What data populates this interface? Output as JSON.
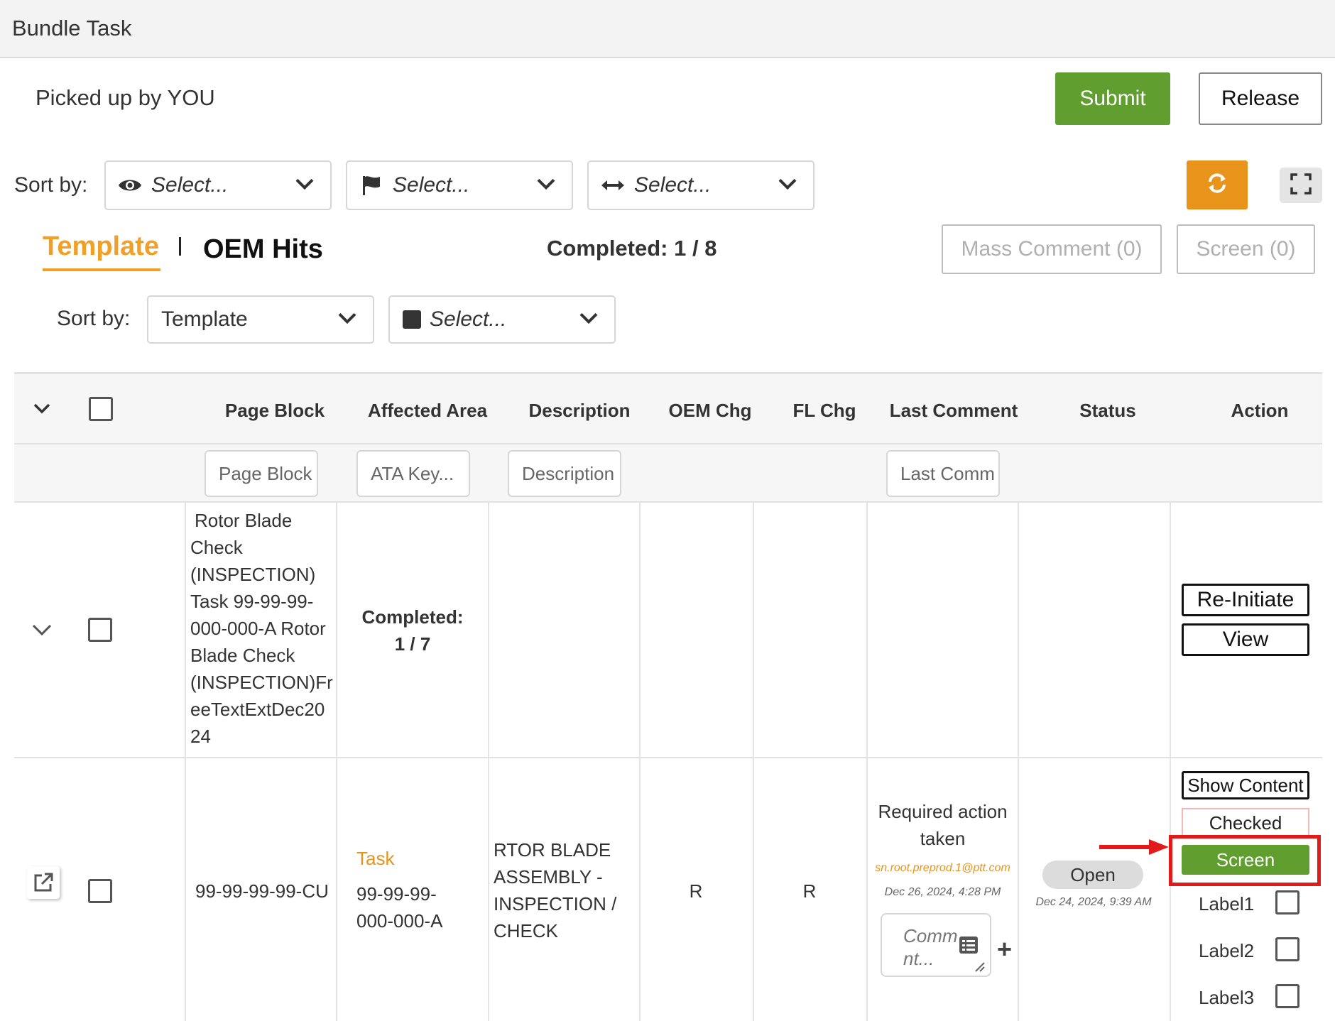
{
  "window": {
    "title": "Bundle Task"
  },
  "header": {
    "picked_by": "Picked up by YOU",
    "submit_label": "Submit",
    "release_label": "Release"
  },
  "sort_bar": {
    "label": "Sort by:",
    "selects": [
      {
        "icon": "eye-icon",
        "placeholder": "Select..."
      },
      {
        "icon": "flag-icon",
        "placeholder": "Select..."
      },
      {
        "icon": "horizontal-arrows-icon",
        "placeholder": "Select..."
      }
    ]
  },
  "tabs": {
    "template_label": "Template",
    "oem_label": "OEM Hits",
    "completed": "Completed: 1 / 8"
  },
  "actions": {
    "mass_comment_label": "Mass Comment (0)",
    "screen_label": "Screen (0)"
  },
  "sort_bar2": {
    "label": "Sort by:",
    "template_value": "Template",
    "color_placeholder": "Select..."
  },
  "table": {
    "columns": [
      "Page Block",
      "Affected Area",
      "Description",
      "OEM Chg",
      "FL Chg",
      "Last Comment",
      "Status",
      "Action"
    ],
    "filters": {
      "page_block": "Page Block",
      "affected_area": "ATA Key...",
      "description": "Description",
      "last_comment": "Last Comm"
    },
    "group_row": {
      "page_block_lines": [
        "Rotor Blade",
        "Check",
        "(INSPECTION)",
        "Task 99-99-99-",
        "000-000-A Rotor",
        "Blade Check",
        "(INSPECTION)Fr",
        "eeTextExtDec20",
        "24"
      ],
      "completed_label": "Completed:",
      "completed_value": "1 / 7",
      "reinitiate_label": "Re-Initiate",
      "view_label": "View"
    },
    "task_row": {
      "page_block": "99-99-99-99-CU",
      "area_type": "Task",
      "area_code_lines": [
        "99-99-99-",
        "000-000-A"
      ],
      "description_lines": [
        "RTOR BLADE",
        "ASSEMBLY -",
        "INSPECTION /",
        "CHECK"
      ],
      "oem_chg": "R",
      "fl_chg": "R",
      "last_comment_lines": [
        "Required action",
        "taken"
      ],
      "comment_author": "sn.root.preprod.1@ptt.com",
      "comment_date": "Dec 26, 2024, 4:28 PM",
      "comment_placeholder_lines": [
        "Comm",
        "nt..."
      ],
      "status": "Open",
      "status_date": "Dec 24, 2024, 9:39 AM",
      "show_content_label": "Show Content",
      "checked_label": "Checked",
      "screen_label": "Screen",
      "labels": [
        "Label1",
        "Label2",
        "Label3"
      ]
    }
  },
  "colors": {
    "green": "#5f9e2f",
    "orange": "#e8931a",
    "tab_orange": "#f0a026",
    "highlight_red": "#e01b1b"
  }
}
